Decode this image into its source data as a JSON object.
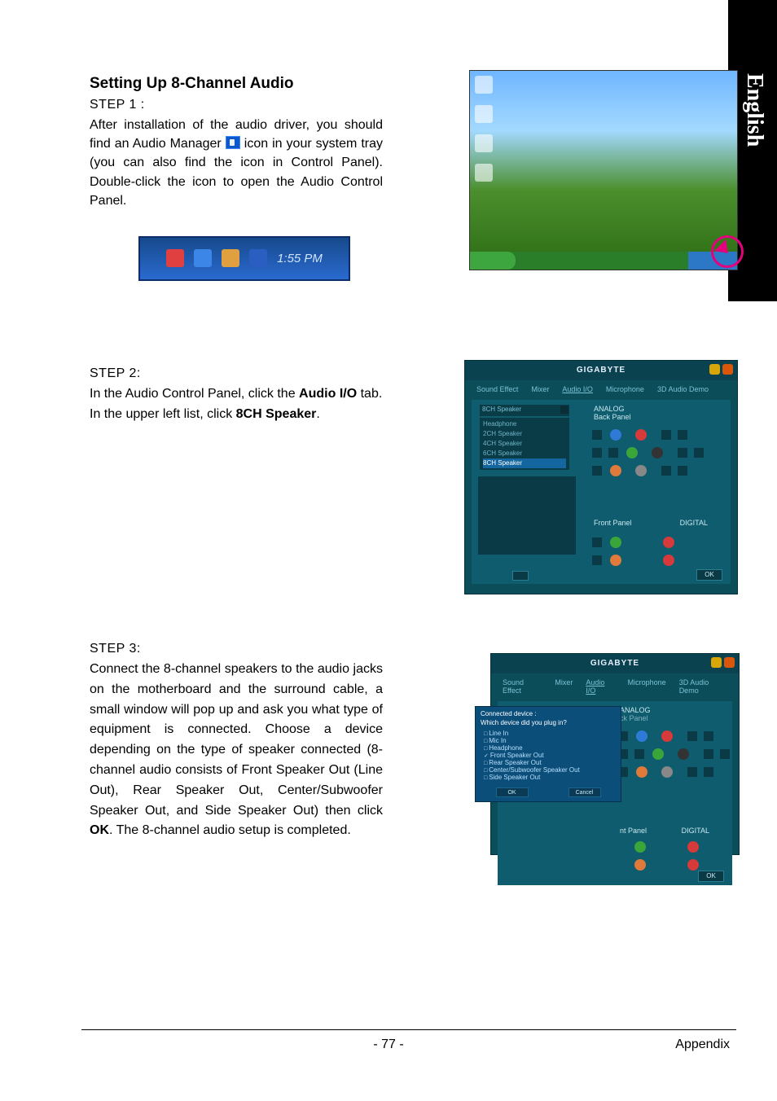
{
  "language_tab": "English",
  "heading": "Setting Up 8-Channel Audio",
  "step1": {
    "label": "STEP 1 :",
    "text_a": "After installation of the audio driver, you should find an Audio Manager",
    "text_b": "icon in your system tray (you can also find the icon in Control Panel). Double-click the icon to open the Audio Control Panel.",
    "tray_time": "1:55 PM"
  },
  "step2": {
    "label": "STEP 2:",
    "text_a": "In the Audio Control Panel, click the ",
    "bold_a": "Audio I/O",
    "text_b": " tab. In the upper left list, click ",
    "bold_b": "8CH Speaker",
    "text_c": "."
  },
  "panel": {
    "brand": "GIGABYTE",
    "tabs": [
      "Sound Effect",
      "Mixer",
      "Audio I/O",
      "Microphone",
      "3D Audio Demo"
    ],
    "selected_tab": "Audio I/O",
    "dropdown_value": "8CH Speaker",
    "list_items": [
      "Headphone",
      "2CH Speaker",
      "4CH Speaker",
      "6CH Speaker",
      "8CH Speaker"
    ],
    "list_selected": "8CH Speaker",
    "analog_label": "ANALOG",
    "back_panel": "Back Panel",
    "front_panel": "Front Panel",
    "digital_label": "DIGITAL",
    "ok": "OK"
  },
  "step3": {
    "label": "STEP 3:",
    "text_a": "Connect the 8-channel speakers to the audio jacks on the motherboard and the surround cable, a small window will pop up and ask you what type of equipment is connected. Choose a device depending on the type of speaker connected (8-channel audio consists of Front Speaker Out (Line Out), Rear Speaker Out, Center/Subwoofer Speaker Out, and Side Speaker Out) then click ",
    "bold_a": "OK",
    "text_b": ". The 8-channel audio setup is completed."
  },
  "popup": {
    "title1": "Connected device :",
    "title2": "Which device did you plug in?",
    "options": [
      "Line In",
      "Mic In",
      "Headphone",
      "Front Speaker Out",
      "Rear Speaker Out",
      "Center/Subwoofer Speaker Out",
      "Side Speaker Out"
    ],
    "checked": "Front Speaker Out",
    "ok": "OK",
    "cancel": "Cancel"
  },
  "footer": {
    "page": "- 77 -",
    "section": "Appendix"
  }
}
